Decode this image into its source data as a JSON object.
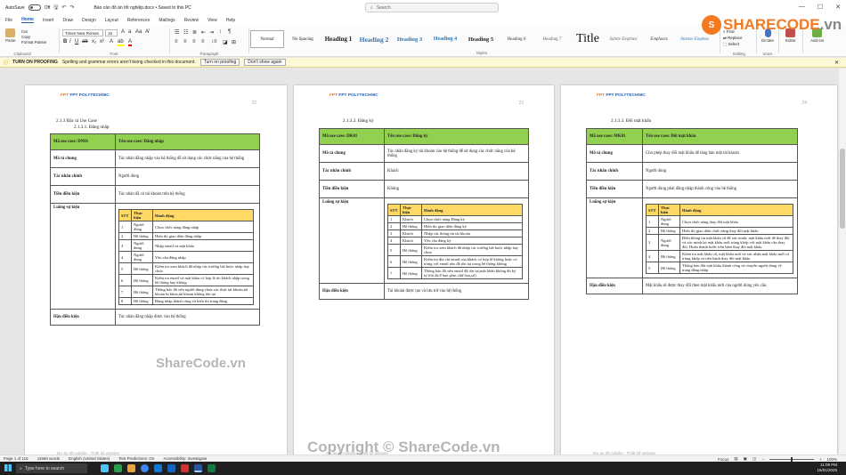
{
  "titlebar": {
    "autosave_label": "AutoSave",
    "autosave_state": "Off",
    "doc_title": "Báo cáo đồ án tốt nghiệp.docx • Saved to this PC",
    "search_placeholder": "Search",
    "window_controls": [
      "—",
      "☐",
      "✕"
    ]
  },
  "menus": [
    "File",
    "Home",
    "Insert",
    "Draw",
    "Design",
    "Layout",
    "References",
    "Mailings",
    "Review",
    "View",
    "Help"
  ],
  "active_menu": "Home",
  "ribbon": {
    "clipboard": {
      "paste": "Paste",
      "cut": "Cut",
      "copy": "Copy",
      "format_painter": "Format Painter",
      "label": "Clipboard"
    },
    "font": {
      "name": "Times New Roman",
      "size": "15",
      "label": "Font"
    },
    "paragraph_label": "Paragraph",
    "styles_label": "Styles",
    "styles": [
      {
        "name": "Normal",
        "size": "5px",
        "color": "#222"
      },
      {
        "name": "No Spacing",
        "size": "5px",
        "color": "#222"
      },
      {
        "name": "Heading 1",
        "size": "7px",
        "color": "#1a1a1a"
      },
      {
        "name": "Heading 2",
        "size": "7.5px",
        "color": "#2e74b5"
      },
      {
        "name": "Heading 3",
        "size": "6.5px",
        "color": "#2e74b5"
      },
      {
        "name": "Heading 4",
        "size": "6px",
        "color": "#2e74b5"
      },
      {
        "name": "Heading 5",
        "size": "6.5px",
        "color": "#1a1a1a"
      },
      {
        "name": "Heading 6",
        "size": "5px",
        "color": "#333"
      },
      {
        "name": "Heading 7",
        "size": "5px",
        "color": "#666"
      },
      {
        "name": "Title",
        "size": "14px",
        "color": "#111"
      },
      {
        "name": "Subtle Emphasi",
        "size": "5px",
        "color": "#666"
      },
      {
        "name": "Emphasis",
        "size": "5px",
        "color": "#333"
      },
      {
        "name": "Intense Emphas",
        "size": "5px",
        "color": "#2e74b5"
      }
    ],
    "editing": {
      "find": "Find",
      "replace": "Replace",
      "select": "Select",
      "label": "Editing"
    },
    "voice": {
      "dictate": "Dictate",
      "label": "Voice"
    },
    "editor": {
      "label": "Editor"
    },
    "addins": {
      "label": "Add-ins"
    }
  },
  "infobar": {
    "label": "TURN ON PROOFING",
    "message": "Spelling and grammar errors aren't being checked in this document.",
    "btn_turn_on": "Turn on proofing",
    "btn_dont_show": "Don't show again"
  },
  "brand": {
    "name": "SHARECODE",
    "suffix": ".vn"
  },
  "watermarks": [
    "ShareCode.vn",
    "Copyright © ShareCode.vn"
  ],
  "pages": [
    {
      "logo": "FPT POLYTECHNIC",
      "page_num": "22",
      "heading1": "2.1.3 Đặc tả Use Case",
      "heading2": "2.1.3.1. Đăng nhập",
      "uc": {
        "code_label": "Mã use case: DN01",
        "name_label": "Tên use case: Đăng nhập"
      },
      "rows": [
        {
          "label": "Mô tả chung",
          "value": "Tác nhân đăng nhập vào hệ thống để sử dụng các chức năng của hệ thống"
        },
        {
          "label": "Tác nhân chính",
          "value": "Người dùng"
        },
        {
          "label": "Tiền điều kiện",
          "value": "Tác nhân đã có tài khoản trên hệ thống"
        }
      ],
      "flow_label": "Luồng sự kiện",
      "flow_header": [
        "STT",
        "Thực hiện",
        "Hành động"
      ],
      "flow": [
        [
          "1",
          "Người dùng",
          "Chọn chức năng đăng nhập"
        ],
        [
          "2",
          "Hệ thống",
          "Hiển thị giao diện đăng nhập"
        ],
        [
          "3",
          "Người dùng",
          "Nhập email và mật khẩu"
        ],
        [
          "4",
          "Người dùng",
          "Yêu cầu đăng nhập"
        ],
        [
          "5",
          "Hệ thống",
          "Kiểm tra xem khách đã nhập các trường bắt buộc nhập hay chưa"
        ],
        [
          "6",
          "Hệ thống",
          "Kiểm tra email và mật khẩu có hợp lệ do khách nhập trong hệ thống hay không"
        ],
        [
          "7",
          "Hệ thống",
          "Thông báo lỗi nếu người dùng chưa xác thực tài khoản,tài khoản bị khóa,tài khoản không tồn tại"
        ],
        [
          "8",
          "Hệ thống",
          "Đăng nhập thành công và hiển thị trang đăng"
        ]
      ],
      "post_label": "Hậu điều kiện",
      "post_value": "Tác nhân đăng nhập được vào hệ thống",
      "footer": "Dự án tốt nghiệp - Thiết kế website"
    },
    {
      "logo": "FPT POLYTECHNIC",
      "page_num": "23",
      "heading2": "2.1.3.2. Đăng ký",
      "uc": {
        "code_label": "Mã use case: DK01",
        "name_label": "Tên use case: Đăng ký"
      },
      "rows": [
        {
          "label": "Mô tả chung",
          "value": "Tác nhân đăng ký tài khoản vào hệ thống để sử dụng các chức năng của hệ thống"
        },
        {
          "label": "Tác nhân chính",
          "value": "Khách"
        },
        {
          "label": "Tiền điều kiện",
          "value": "Không"
        }
      ],
      "flow_label": "Luồng sự kiện",
      "flow_header": [
        "STT",
        "Thực hiện",
        "Hành động"
      ],
      "flow": [
        [
          "1",
          "Khách",
          "Chọn chức năng Đăng ký"
        ],
        [
          "2",
          "Hệ thống",
          "Hiển thị giao diện đăng ký"
        ],
        [
          "3",
          "Khách",
          "Nhập các thông tin tài khoản"
        ],
        [
          "4",
          "Khách",
          "Yêu cầu đăng ký"
        ],
        [
          "5",
          "Hệ thống",
          "Kiểm tra xem khách đã nhập các trường bắt buộc nhập hay chưa"
        ],
        [
          "6",
          "Hệ thống",
          "Kiểm tra địa chỉ email của khách có hợp lệ không hoặc có trùng với email nào đã tồn tại trong hệ thống không"
        ],
        [
          "7",
          "Hệ thống",
          "Thông báo lỗi nếu email đã tồn tại,mật khẩu không đủ ký tự (tối đa 8 bao gồm chữ hoa,số)"
        ]
      ],
      "post_label": "Hậu điều kiện",
      "post_value": "Tài khoản được tạo và lưu trữ vào hệ thống",
      "footer": "Dự án tốt nghiệp - Thiết kế website"
    },
    {
      "logo": "FPT POLYTECHNIC",
      "page_num": "24",
      "heading2": "2.1.3.3. Đổi mật khẩu",
      "uc": {
        "code_label": "Mã use case: MK01",
        "name_label": "Tên use case: Đổi mật khẩu"
      },
      "rows": [
        {
          "label": "Mô tả chung",
          "value": "Cho phép thay đổi mật khẩu để tăng bảo mật tài khoản"
        },
        {
          "label": "Tác nhân chính",
          "value": "Người dùng"
        },
        {
          "label": "Tiền điều kiện",
          "value": "Người dùng phải đăng nhập thành công vào hệ thống"
        }
      ],
      "flow_label": "Luồng sự kiện",
      "flow_header": [
        "STT",
        "Thực hiện",
        "Hành động"
      ],
      "flow": [
        [
          "1",
          "Người dùng",
          "Chọn chức năng thay đổi mật khẩu"
        ],
        [
          "2",
          "Hệ thống",
          "Hiển thị giao diện chức năng thay đổi mật khẩu"
        ],
        [
          "3",
          "Người dùng",
          "Điền thông tin mật khẩu cũ để xác minh, mật khẩu mới để thay đổi và xác minh lại mật khẩu mới trùng khớp với mật khẩu cần thay đổi. Hoàn thành bước trên bấm thay đổi mật khẩu"
        ],
        [
          "4",
          "Hệ thống",
          "Kiểm tra mật khẩu cũ, mật khẩu mới và xác nhận mật khẩu mới có trùng khớp và tiến hành thay đổi mật khẩu"
        ],
        [
          "5",
          "Hệ thống",
          "Thông báo đổi mật khẩu thành công và chuyển người dùng về trang đăng nhập"
        ]
      ],
      "post_label": "Hậu điều kiện",
      "post_value": "Mật khẩu sẽ được thay đổi theo mật khẩu mới của người dùng yêu cầu.",
      "footer": "Dự án tốt nghiệp - Thiết kế website"
    }
  ],
  "statusbar": {
    "page": "Page 1 of 116",
    "words": "11660 words",
    "lang": "English (United States)",
    "predictions": "Text Predictions: On",
    "accessibility": "Accessibility: Investigate",
    "focus": "Focus",
    "zoom": "100%"
  },
  "taskbar": {
    "search_placeholder": "Type here to search",
    "time": "11:09 PM",
    "date": "15/01/2025"
  }
}
